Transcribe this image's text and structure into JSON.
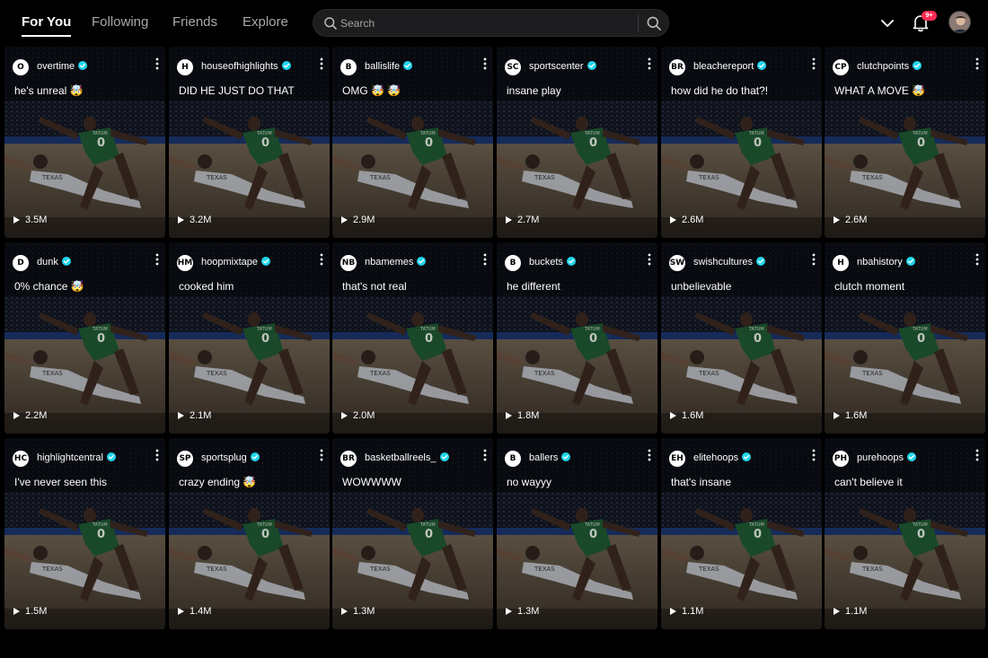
{
  "nav": {
    "tabs": [
      {
        "label": "For You",
        "active": true
      },
      {
        "label": "Following",
        "active": false
      },
      {
        "label": "Friends",
        "active": false
      },
      {
        "label": "Explore",
        "active": false
      }
    ]
  },
  "search": {
    "placeholder": "Search",
    "icon": "search-icon"
  },
  "header_actions": {
    "menu_icon": "chevron-down-icon",
    "notifications_icon": "bell-icon",
    "notifications_badge": "9+",
    "avatar_icon": "user-avatar"
  },
  "colors": {
    "background": "#000000",
    "verified": "#20d5ec",
    "badge": "#fe2c55",
    "search_bg": "#1d1d1f"
  },
  "videos": [
    {
      "channel": "overtime",
      "logo": "O",
      "caption": "he's unreal 🤯",
      "views": "3.5M"
    },
    {
      "channel": "houseofhighlights",
      "logo": "H",
      "caption": "DID HE JUST DO THAT",
      "views": "3.2M"
    },
    {
      "channel": "ballislife",
      "logo": "B",
      "caption": "OMG 🤯 🤯",
      "views": "2.9M"
    },
    {
      "channel": "sportscenter",
      "logo": "SC",
      "caption": "insane play",
      "views": "2.7M"
    },
    {
      "channel": "bleachereport",
      "logo": "BR",
      "caption": "how did he do that?!",
      "views": "2.6M"
    },
    {
      "channel": "clutchpoints",
      "logo": "CP",
      "caption": "WHAT A MOVE 🤯",
      "views": "2.6M"
    },
    {
      "channel": "dunk",
      "logo": "D",
      "caption": "0% chance 🤯",
      "views": "2.2M"
    },
    {
      "channel": "hoopmixtape",
      "logo": "HM",
      "caption": "cooked him",
      "views": "2.1M"
    },
    {
      "channel": "nbamemes",
      "logo": "NB",
      "caption": "that's not real",
      "views": "2.0M"
    },
    {
      "channel": "buckets",
      "logo": "B",
      "caption": "he different",
      "views": "1.8M"
    },
    {
      "channel": "swishcultures",
      "logo": "SW",
      "caption": "unbelievable",
      "views": "1.6M"
    },
    {
      "channel": "nbahistory",
      "logo": "H",
      "caption": "clutch moment",
      "views": "1.6M"
    },
    {
      "channel": "highlightcentral",
      "logo": "HC",
      "caption": "I've never seen this",
      "views": "1.5M"
    },
    {
      "channel": "sportsplug",
      "logo": "SP",
      "caption": "crazy ending 🤯",
      "views": "1.4M"
    },
    {
      "channel": "basketballreels_",
      "logo": "BR",
      "caption": "WOWWWW",
      "views": "1.3M"
    },
    {
      "channel": "ballers",
      "logo": "B",
      "caption": "no wayyy",
      "views": "1.3M"
    },
    {
      "channel": "elitehoops",
      "logo": "EH",
      "caption": "that's insane",
      "views": "1.1M"
    },
    {
      "channel": "purehoops",
      "logo": "PH",
      "caption": "can't believe it",
      "views": "1.1M"
    }
  ]
}
